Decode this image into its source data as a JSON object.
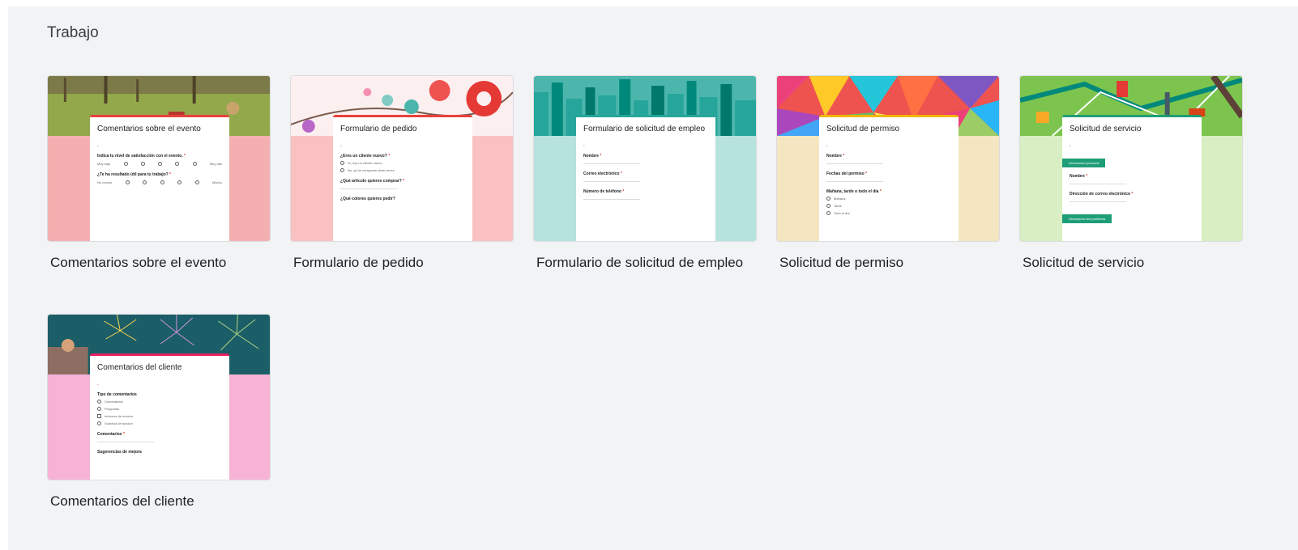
{
  "section": {
    "title": "Trabajo"
  },
  "templates": [
    {
      "label": "Comentarios sobre el evento",
      "form_title": "Comentarios sobre el evento",
      "accent": "#e8413c",
      "background": "#f4b0b0",
      "header_theme": "park-photo",
      "questions": [
        "Indica tu nivel de satisfacción con el evento.",
        "¿Te ha resultado útil para tu trabajo?"
      ],
      "scale_ends": [
        "Muy bajo",
        "Muy alto",
        "No mucho",
        "Mucho"
      ]
    },
    {
      "label": "Formulario de pedido",
      "form_title": "Formulario de pedido",
      "accent": "#e8413c",
      "background": "#f9c1c1",
      "header_theme": "flowers",
      "questions": [
        "¿Eres un cliente nuevo?",
        "¿Qué artículo quieres comprar?",
        "¿Qué colores quieres pedir?"
      ],
      "options": [
        "Sí, soy un cliente nuevo",
        "No, ya he comprado otras veces"
      ]
    },
    {
      "label": "Formulario de solicitud de empleo",
      "form_title": "Formulario de solicitud de empleo",
      "accent": "#26a69a",
      "background": "#b7e3df",
      "header_theme": "city-skyline",
      "questions": [
        "Nombre",
        "Correo electrónico",
        "Número de teléfono"
      ]
    },
    {
      "label": "Solicitud de permiso",
      "form_title": "Solicitud de permiso",
      "accent": "#f2b705",
      "background": "#f3e6c1",
      "header_theme": "colorful-triangles",
      "questions": [
        "Nombre",
        "Fechas del permiso",
        "Mañana, tarde o todo el día"
      ],
      "options": [
        "Mañana",
        "Tarde",
        "Todo el día"
      ]
    },
    {
      "label": "Solicitud de servicio",
      "form_title": "Solicitud de servicio",
      "accent": "#1e9e76",
      "background": "#d7efc3",
      "header_theme": "green-map",
      "questions": [
        "Nombre",
        "Dirección de correo electrónico"
      ],
      "pills": [
        "Información personal",
        "Descripción del problema"
      ]
    },
    {
      "label": "Comentarios del cliente",
      "form_title": "Comentarios del cliente",
      "accent": "#e91e63",
      "background": "#f7b3d5",
      "header_theme": "fireworks",
      "questions": [
        "Tipo de comentarios",
        "Comentarios",
        "Sugerencias de mejora"
      ],
      "options": [
        "Comentarios",
        "Preguntas",
        "Informes de errores",
        "Solicitud de función"
      ]
    }
  ]
}
